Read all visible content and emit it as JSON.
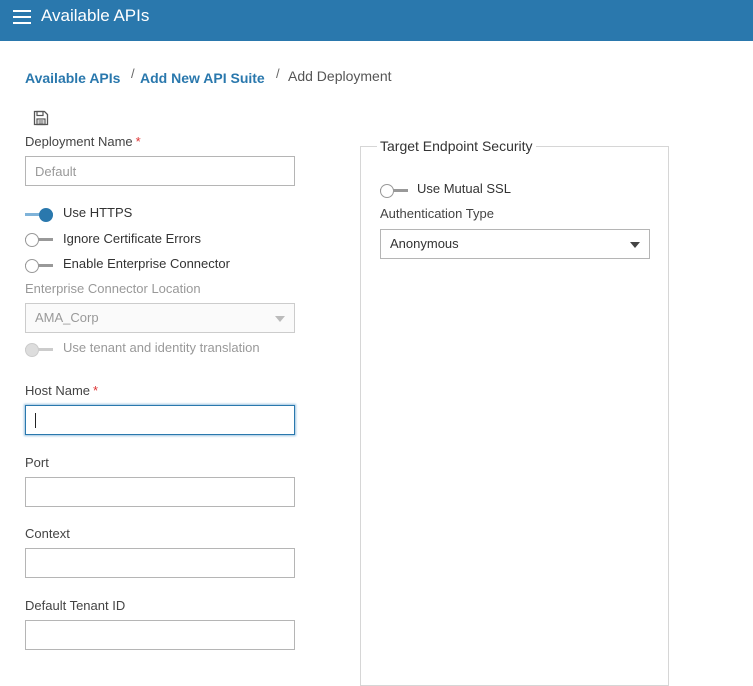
{
  "header": {
    "title": "Available APIs"
  },
  "breadcrumb": {
    "items": [
      "Available APIs",
      "Add New API Suite"
    ],
    "separator": "/",
    "current": "Add Deployment"
  },
  "form": {
    "deployment_name": {
      "label": "Deployment Name",
      "required_mark": "*",
      "value": "Default"
    },
    "toggles": [
      {
        "label": "Use HTTPS",
        "state": "on"
      },
      {
        "label": "Ignore Certificate Errors",
        "state": "off"
      },
      {
        "label": "Enable Enterprise Connector",
        "state": "off"
      }
    ],
    "enterprise_connector_location": {
      "label": "Enterprise Connector Location",
      "value": "AMA_Corp"
    },
    "tenant_translation": {
      "label": "Use tenant and identity translation",
      "state": "disabled"
    },
    "host_name": {
      "label": "Host Name",
      "required_mark": "*",
      "value": ""
    },
    "port": {
      "label": "Port",
      "value": ""
    },
    "context": {
      "label": "Context",
      "value": ""
    },
    "default_tenant_id": {
      "label": "Default Tenant ID",
      "value": ""
    }
  },
  "target_endpoint_security": {
    "title": "Target Endpoint Security",
    "mutual_ssl": {
      "label": "Use Mutual SSL",
      "state": "off"
    },
    "auth_type": {
      "label": "Authentication Type",
      "value": "Anonymous"
    }
  },
  "colors": {
    "header": "#2a78ad",
    "accent": "#2a78ad",
    "required": "#dd3333"
  },
  "icons": {
    "menu": "hamburger-menu-icon",
    "save": "save-icon",
    "dropdown": "chevron-down-icon"
  }
}
